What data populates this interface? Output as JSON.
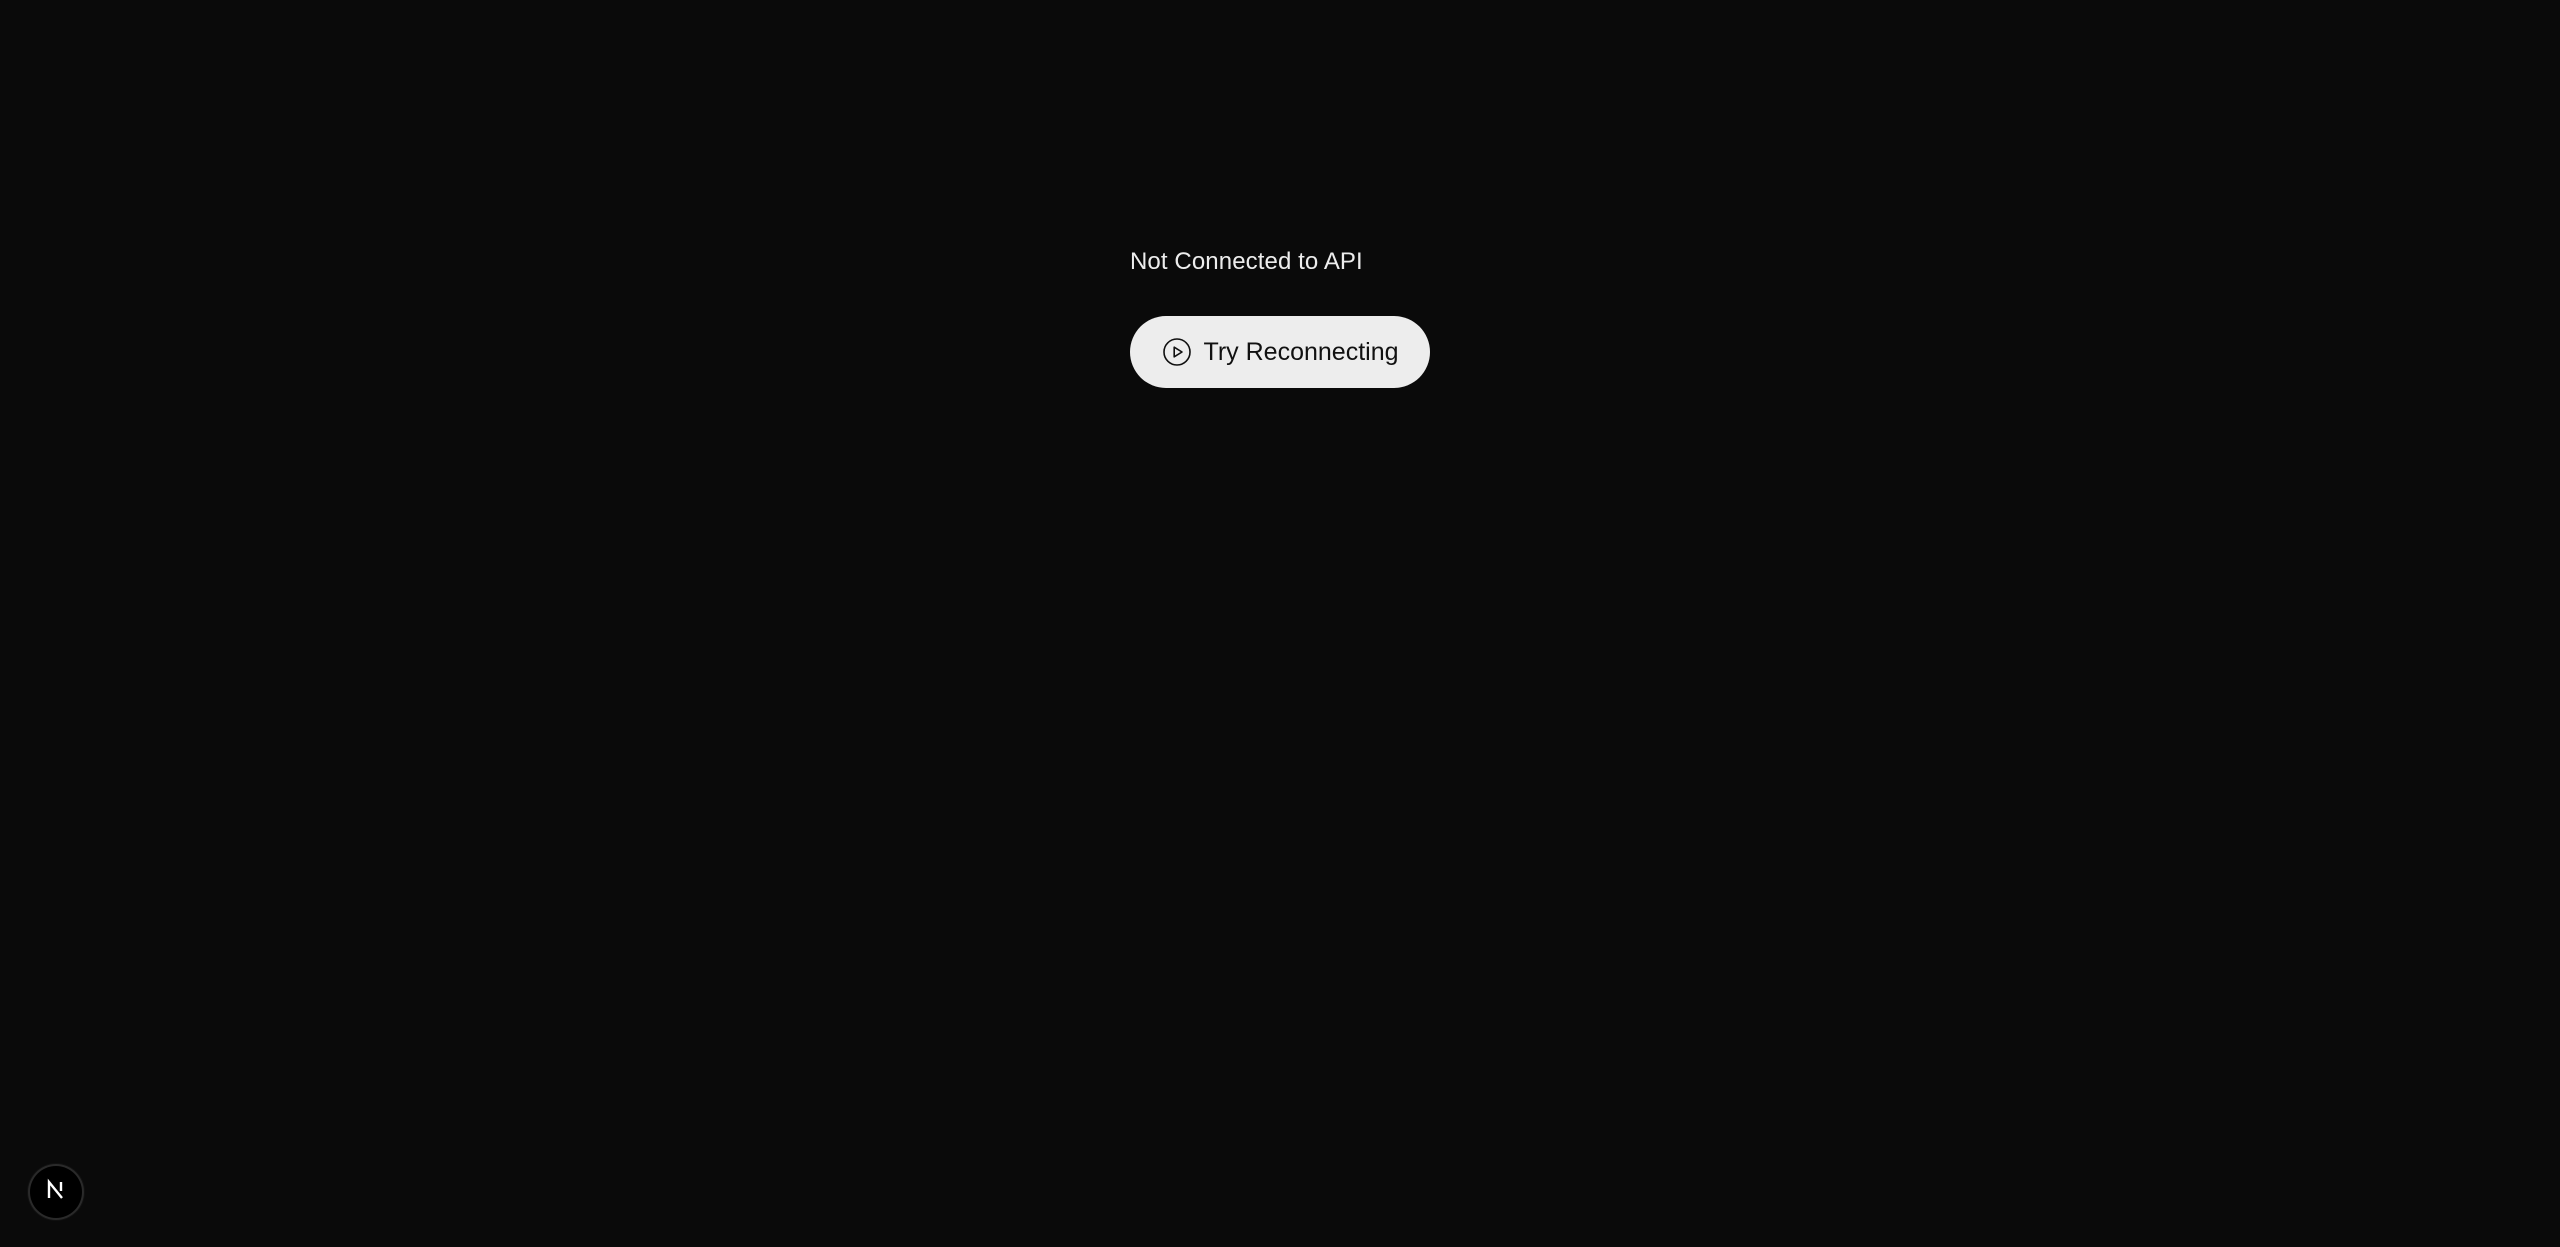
{
  "status": {
    "message": "Not Connected to API"
  },
  "reconnect": {
    "label": "Try Reconnecting",
    "icon": "play-circle-icon"
  },
  "dev_badge": {
    "icon": "nextjs-logo-icon"
  },
  "colors": {
    "background": "#0a0a0a",
    "text": "#ededed",
    "button_bg": "#ededed",
    "button_text": "#111111"
  }
}
